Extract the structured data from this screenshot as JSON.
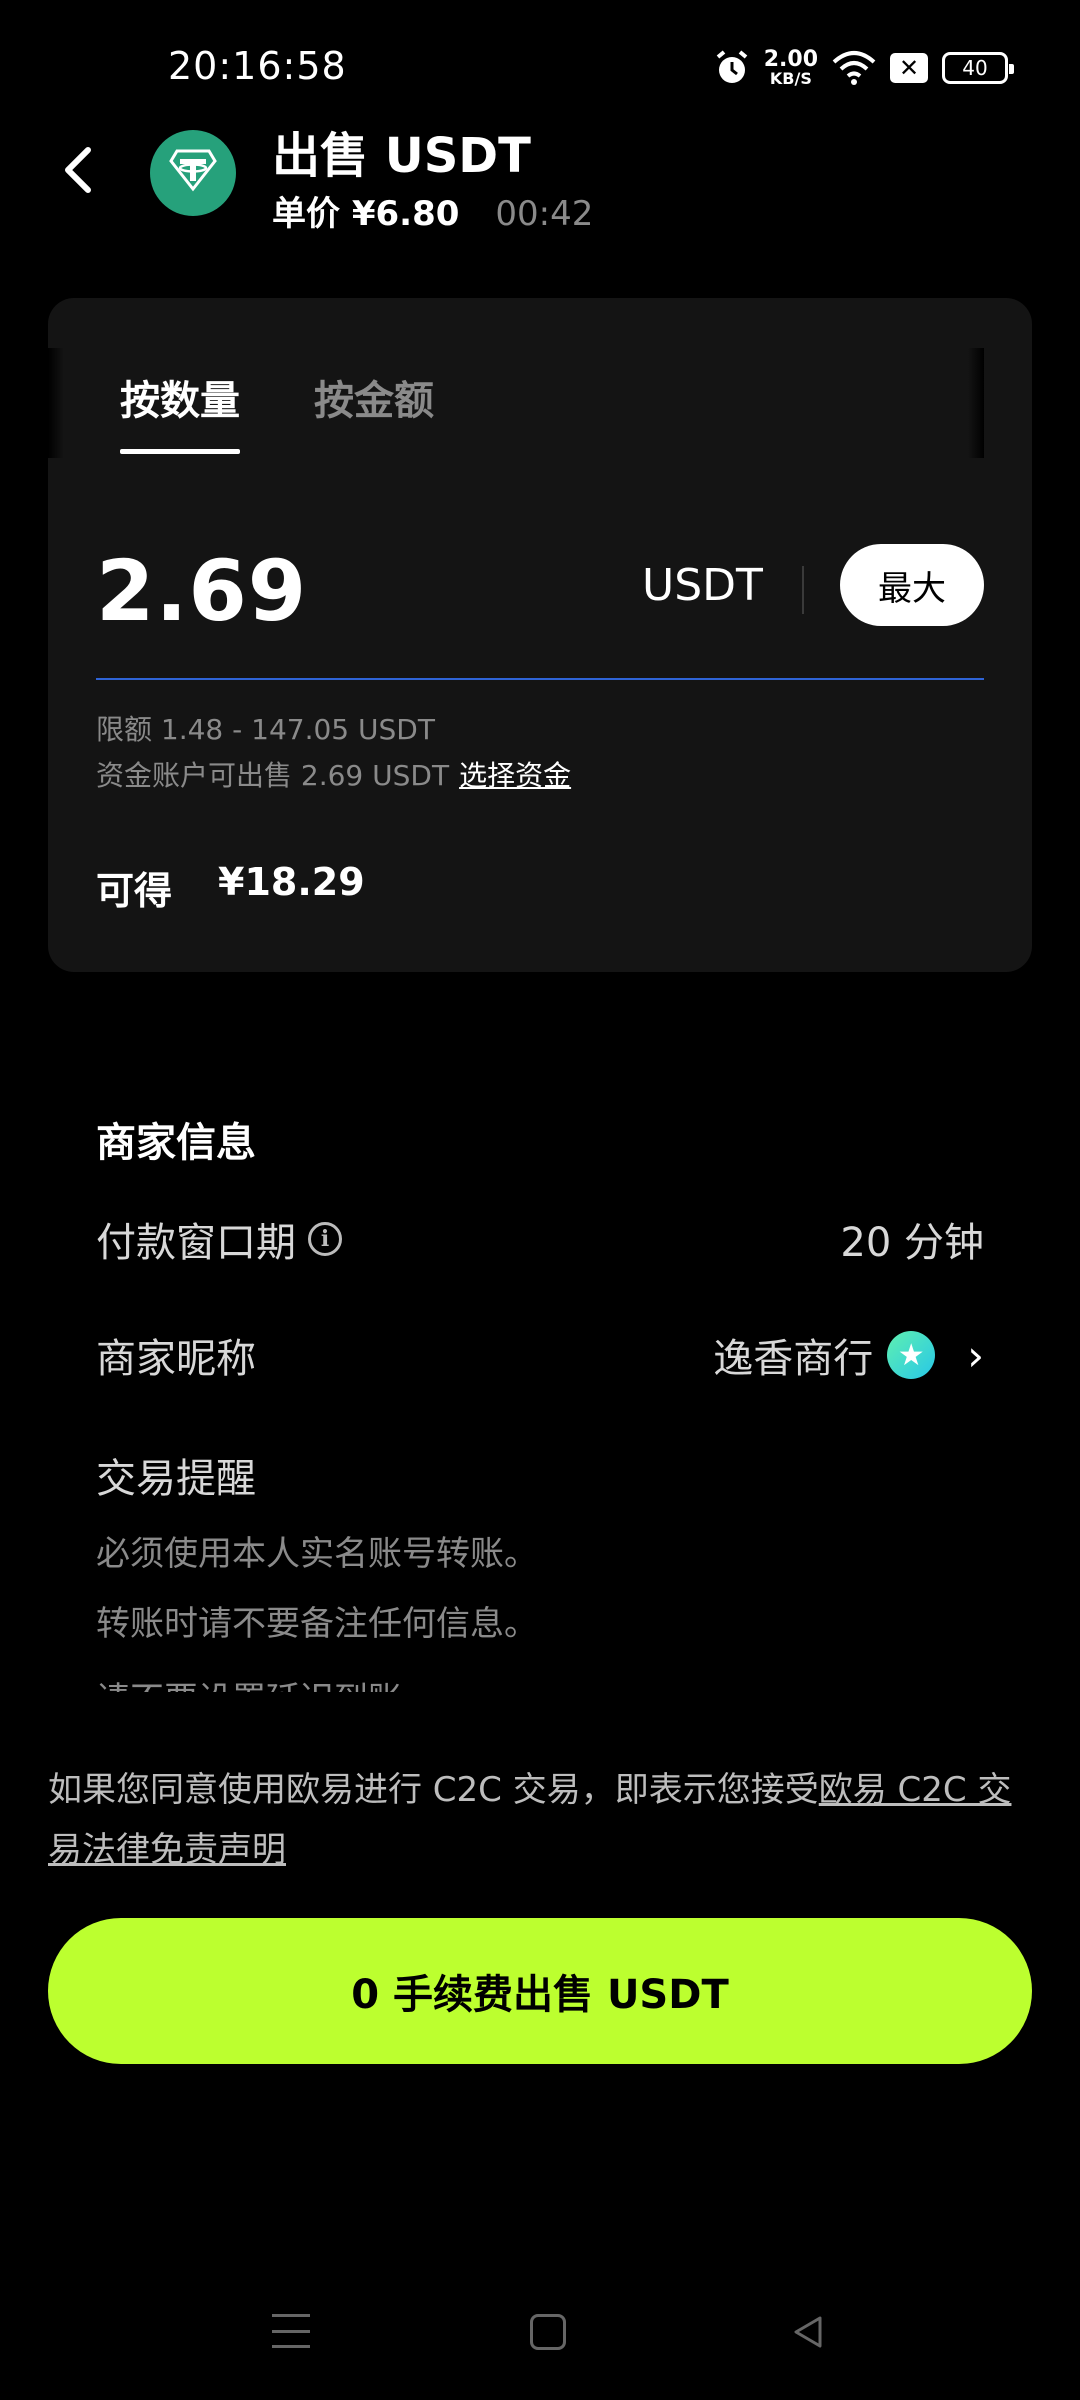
{
  "status_bar": {
    "time": "20:16:58",
    "net_speed_value": "2.00",
    "net_speed_unit": "KB/S",
    "battery": "40",
    "icons": [
      "alarm-icon",
      "wifi-icon",
      "close-box-icon",
      "battery-icon"
    ]
  },
  "header": {
    "title": "出售 USDT",
    "unit_price": "单价 ¥6.80",
    "countdown": "00:42",
    "coin_icon": "tether-logo"
  },
  "card": {
    "tabs": [
      {
        "label": "按数量",
        "active": true
      },
      {
        "label": "按金额",
        "active": false
      }
    ],
    "amount": "2.69",
    "unit": "USDT",
    "max_label": "最大",
    "limit_text": "限额 1.48 - 147.05 USDT",
    "available_text": "资金账户可出售  2.69 USDT",
    "select_funds_label": "选择资金",
    "receive_label": "可得",
    "receive_value": "¥18.29"
  },
  "merchant": {
    "section_title": "商家信息",
    "payment_window_label": "付款窗口期",
    "payment_window_value": "20 分钟",
    "nickname_label": "商家昵称",
    "nickname_value": "逸香商行",
    "tips_title": "交易提醒",
    "tips": [
      "必须使用本人实名账号转账。",
      "转账时请不要备注任何信息。",
      "请不要设置延迟到账"
    ]
  },
  "disclaimer": {
    "text": "如果您同意使用欧易进行 C2C 交易，即表示您接受",
    "link": "欧易 C2C 交易法律免责声明"
  },
  "cta": {
    "label": "0 手续费出售 USDT"
  },
  "colors": {
    "accent_green": "#bcff2f",
    "input_line_blue": "#2f64d6",
    "tether_green": "#26a17b"
  }
}
